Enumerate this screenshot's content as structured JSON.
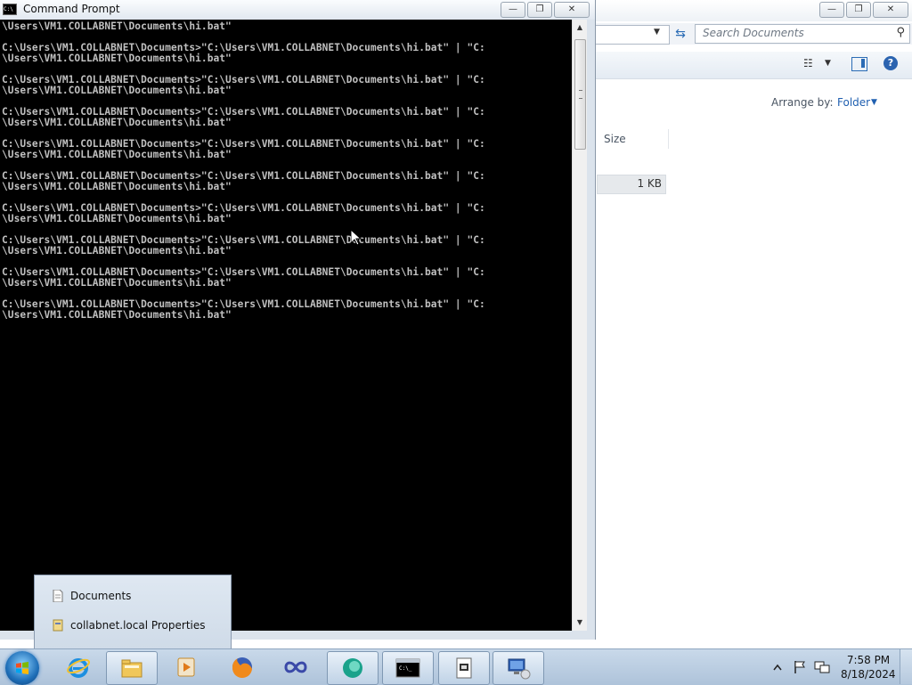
{
  "explorer": {
    "search_placeholder": "Search Documents",
    "arrange_by_label": "Arrange by:",
    "arrange_by_value": "Folder",
    "column_size": "Size",
    "file_size": "1 KB",
    "controls": {
      "minimize": "—",
      "maximize": "❐",
      "close": "✕"
    }
  },
  "cmd": {
    "title": "Command Prompt",
    "controls": {
      "minimize": "—",
      "maximize": "❐",
      "close": "✕"
    },
    "console_lines": [
      "\\Users\\VM1.COLLABNET\\Documents\\hi.bat\"",
      "",
      "C:\\Users\\VM1.COLLABNET\\Documents>\"C:\\Users\\VM1.COLLABNET\\Documents\\hi.bat\" | \"C:",
      "\\Users\\VM1.COLLABNET\\Documents\\hi.bat\"",
      "",
      "C:\\Users\\VM1.COLLABNET\\Documents>\"C:\\Users\\VM1.COLLABNET\\Documents\\hi.bat\" | \"C:",
      "\\Users\\VM1.COLLABNET\\Documents\\hi.bat\"",
      "",
      "C:\\Users\\VM1.COLLABNET\\Documents>\"C:\\Users\\VM1.COLLABNET\\Documents\\hi.bat\" | \"C:",
      "\\Users\\VM1.COLLABNET\\Documents\\hi.bat\"",
      "",
      "C:\\Users\\VM1.COLLABNET\\Documents>\"C:\\Users\\VM1.COLLABNET\\Documents\\hi.bat\" | \"C:",
      "\\Users\\VM1.COLLABNET\\Documents\\hi.bat\"",
      "",
      "C:\\Users\\VM1.COLLABNET\\Documents>\"C:\\Users\\VM1.COLLABNET\\Documents\\hi.bat\" | \"C:",
      "\\Users\\VM1.COLLABNET\\Documents\\hi.bat\"",
      "",
      "C:\\Users\\VM1.COLLABNET\\Documents>\"C:\\Users\\VM1.COLLABNET\\Documents\\hi.bat\" | \"C:",
      "\\Users\\VM1.COLLABNET\\Documents\\hi.bat\"",
      "",
      "C:\\Users\\VM1.COLLABNET\\Documents>\"C:\\Users\\VM1.COLLABNET\\Documents\\hi.bat\" | \"C:",
      "\\Users\\VM1.COLLABNET\\Documents\\hi.bat\"",
      "",
      "C:\\Users\\VM1.COLLABNET\\Documents>\"C:\\Users\\VM1.COLLABNET\\Documents\\hi.bat\" | \"C:",
      "\\Users\\VM1.COLLABNET\\Documents\\hi.bat\"",
      "",
      "C:\\Users\\VM1.COLLABNET\\Documents>\"C:\\Users\\VM1.COLLABNET\\Documents\\hi.bat\" | \"C:",
      "\\Users\\VM1.COLLABNET\\Documents\\hi.bat\""
    ]
  },
  "jumplist": {
    "items": [
      {
        "label": "Documents",
        "icon": "document-icon"
      },
      {
        "label": "collabnet.local Properties",
        "icon": "shortcut-icon"
      }
    ]
  },
  "taskbar": {
    "items": [
      {
        "name": "internet-explorer",
        "icon": "internet-explorer-icon"
      },
      {
        "name": "windows-explorer",
        "icon": "folder-icon",
        "active": true
      },
      {
        "name": "media-player",
        "icon": "media-player-icon"
      },
      {
        "name": "firefox",
        "icon": "firefox-icon"
      },
      {
        "name": "infinity-app",
        "icon": "infinity-icon"
      },
      {
        "name": "green-circle-app",
        "icon": "globe-icon"
      },
      {
        "name": "command-prompt",
        "icon": "cmd-icon",
        "active": true
      },
      {
        "name": "notepad",
        "icon": "notepad-icon",
        "active": true
      },
      {
        "name": "remote-desktop",
        "icon": "remote-desktop-icon",
        "active": true
      }
    ],
    "clock_time": "7:58 PM",
    "clock_date": "8/18/2024"
  },
  "colors": {
    "console_bg": "#000000",
    "console_fg": "#c0c0c0",
    "taskbar": "#b9cde2",
    "link_blue": "#1f5fb0"
  }
}
